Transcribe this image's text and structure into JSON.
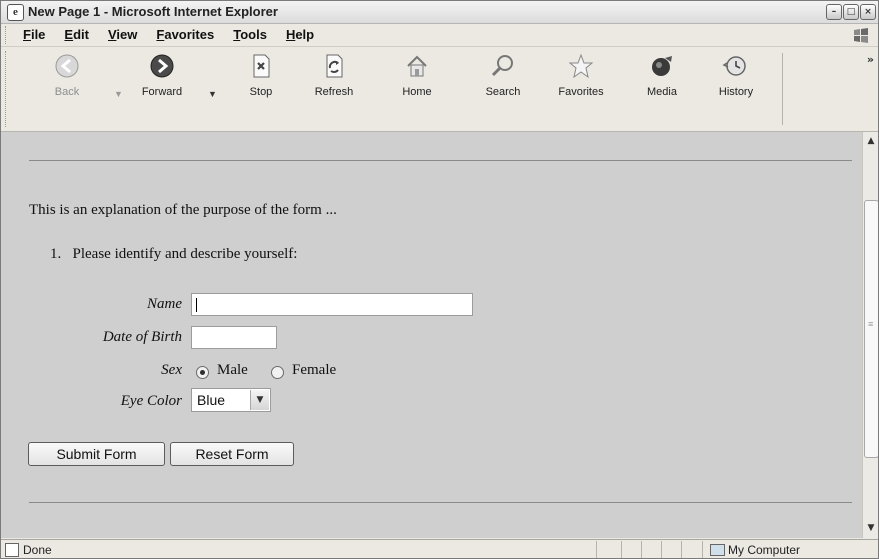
{
  "window": {
    "title": "New Page 1 - Microsoft Internet Explorer"
  },
  "menu": [
    "File",
    "Edit",
    "View",
    "Favorites",
    "Tools",
    "Help"
  ],
  "toolbar": {
    "back": "Back",
    "forward": "Forward",
    "stop": "Stop",
    "refresh": "Refresh",
    "home": "Home",
    "search": "Search",
    "favorites": "Favorites",
    "media": "Media",
    "history": "History",
    "overflow": "»"
  },
  "page": {
    "intro": "This is an explanation of the purpose of the form ...",
    "item_number": "1.",
    "item_text": "Please identify and describe yourself:",
    "form": {
      "name_label": "Name",
      "name_value": "",
      "dob_label": "Date of Birth",
      "dob_value": "",
      "sex_label": "Sex",
      "sex_options": [
        "Male",
        "Female"
      ],
      "sex_selected": "Male",
      "eye_label": "Eye Color",
      "eye_value": "Blue",
      "submit": "Submit Form",
      "reset": "Reset Form"
    }
  },
  "status": {
    "text": "Done",
    "zone": "My Computer"
  },
  "icons": {
    "app": "ie-page-icon",
    "back": "back-arrow-icon",
    "forward": "forward-arrow-icon",
    "stop": "stop-icon",
    "refresh": "refresh-icon",
    "home": "home-icon",
    "search": "magnifier-icon",
    "favorites": "star-icon",
    "media": "media-icon",
    "history": "history-icon"
  }
}
